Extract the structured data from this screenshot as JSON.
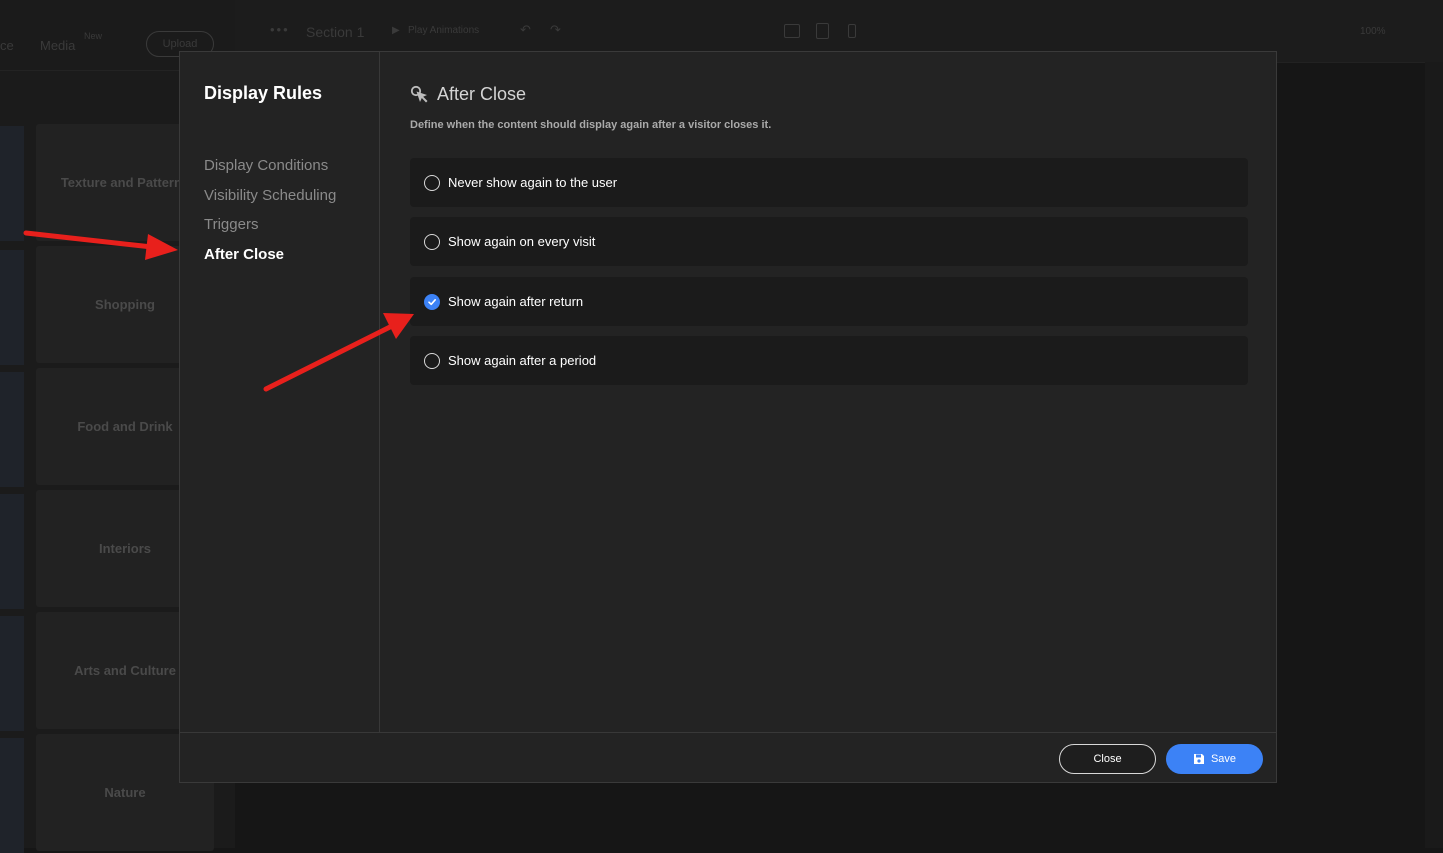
{
  "background": {
    "top_left_labels": [
      "ce",
      "Media"
    ],
    "media_badge": "New",
    "upload_label": "Upload",
    "toolbar": {
      "section_label": "Section 1",
      "play_label": "Play Animations",
      "zoom_label": "100%"
    },
    "categories": [
      "Texture and Patterns",
      "Shopping",
      "Food and Drink",
      "Interiors",
      "Arts and Culture",
      "Nature"
    ]
  },
  "modal": {
    "title": "Display Rules",
    "nav": [
      {
        "label": "Display Conditions",
        "active": false
      },
      {
        "label": "Visibility Scheduling",
        "active": false
      },
      {
        "label": "Triggers",
        "active": false
      },
      {
        "label": "After Close",
        "active": true
      }
    ],
    "section": {
      "icon": "cursor-click-icon",
      "title": "After Close",
      "description": "Define when the content should display again after a visitor closes it.",
      "options": [
        {
          "label": "Never show again to the user",
          "checked": false
        },
        {
          "label": "Show again on every visit",
          "checked": false
        },
        {
          "label": "Show again after return",
          "checked": true
        },
        {
          "label": "Show again after a period",
          "checked": false
        }
      ]
    },
    "footer": {
      "close_label": "Close",
      "save_label": "Save",
      "save_icon": "floppy-disk-icon"
    }
  },
  "annotations": {
    "arrow_color": "#e8201c"
  },
  "colors": {
    "accent": "#3c82f6",
    "modal_bg": "#232323",
    "option_bg": "#1b1b1b"
  }
}
